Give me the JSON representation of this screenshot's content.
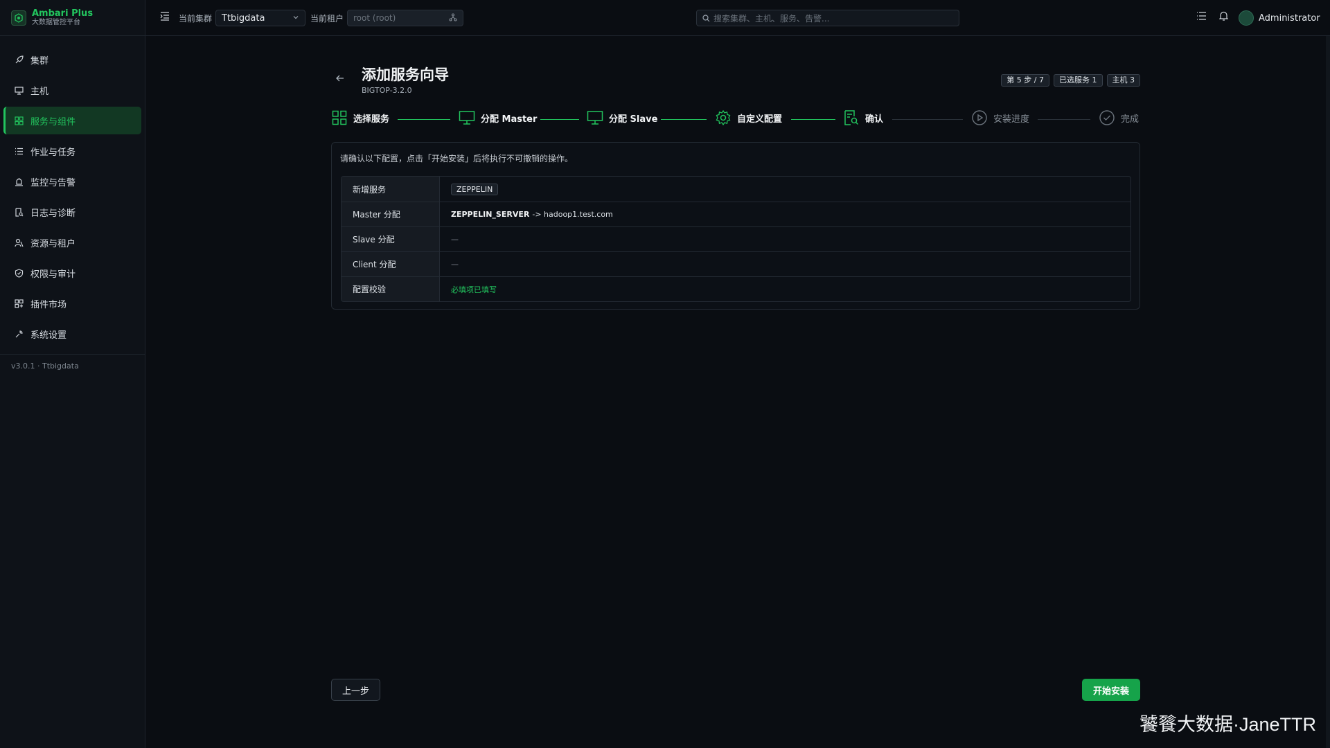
{
  "brand": {
    "title": "Ambari Plus",
    "subtitle": "大数据管控平台"
  },
  "sidebar": {
    "items": [
      {
        "label": "集群",
        "icon": "rocket-icon",
        "active": false
      },
      {
        "label": "主机",
        "icon": "monitor-icon",
        "active": false
      },
      {
        "label": "服务与组件",
        "icon": "grid-icon",
        "active": true
      },
      {
        "label": "作业与任务",
        "icon": "list-icon",
        "active": false
      },
      {
        "label": "监控与告警",
        "icon": "alarm-icon",
        "active": false
      },
      {
        "label": "日志与诊断",
        "icon": "log-search-icon",
        "active": false
      },
      {
        "label": "资源与租户",
        "icon": "user-group-icon",
        "active": false
      },
      {
        "label": "权限与审计",
        "icon": "shield-icon",
        "active": false
      },
      {
        "label": "插件市场",
        "icon": "plugin-icon",
        "active": false
      },
      {
        "label": "系统设置",
        "icon": "wrench-icon",
        "active": false
      }
    ],
    "version": "v3.0.1 · Ttbigdata"
  },
  "topbar": {
    "cluster_label": "当前集群",
    "cluster_value": "Ttbigdata",
    "tenant_label": "当前租户",
    "tenant_value": "root (root)",
    "search_placeholder": "搜索集群、主机、服务、告警...",
    "user": "Administrator"
  },
  "wizard": {
    "title": "添加服务向导",
    "stack": "BIGTOP-3.2.0",
    "badges": [
      "第 5 步 / 7",
      "已选服务 1",
      "主机 3"
    ],
    "steps": [
      {
        "label": "选择服务",
        "icon": "grid-icon",
        "done": true
      },
      {
        "label": "分配 Master",
        "icon": "monitor-icon",
        "done": true
      },
      {
        "label": "分配 Slave",
        "icon": "monitor-icon",
        "done": true
      },
      {
        "label": "自定义配置",
        "icon": "gear-icon",
        "done": true
      },
      {
        "label": "确认",
        "icon": "doc-search-icon",
        "done": true
      },
      {
        "label": "安装进度",
        "icon": "play-circle-icon",
        "done": false
      },
      {
        "label": "完成",
        "icon": "check-circle-icon",
        "done": false
      }
    ],
    "note": "请确认以下配置，点击「开始安装」后将执行不可撤销的操作。",
    "rows": {
      "new_service_key": "新增服务",
      "new_service_value": "ZEPPELIN",
      "master_key": "Master 分配",
      "master_component": "ZEPPELIN_SERVER",
      "master_target": "-> hadoop1.test.com",
      "slave_key": "Slave 分配",
      "slave_value": "—",
      "client_key": "Client 分配",
      "client_value": "—",
      "check_key": "配置校验",
      "check_value": "必填项已填写"
    },
    "prev_button": "上一步",
    "start_button": "开始安装"
  },
  "colors": {
    "accent": "#22c55e",
    "background": "#0a0d12"
  },
  "watermark": "饕餮大数据·JaneTTR"
}
